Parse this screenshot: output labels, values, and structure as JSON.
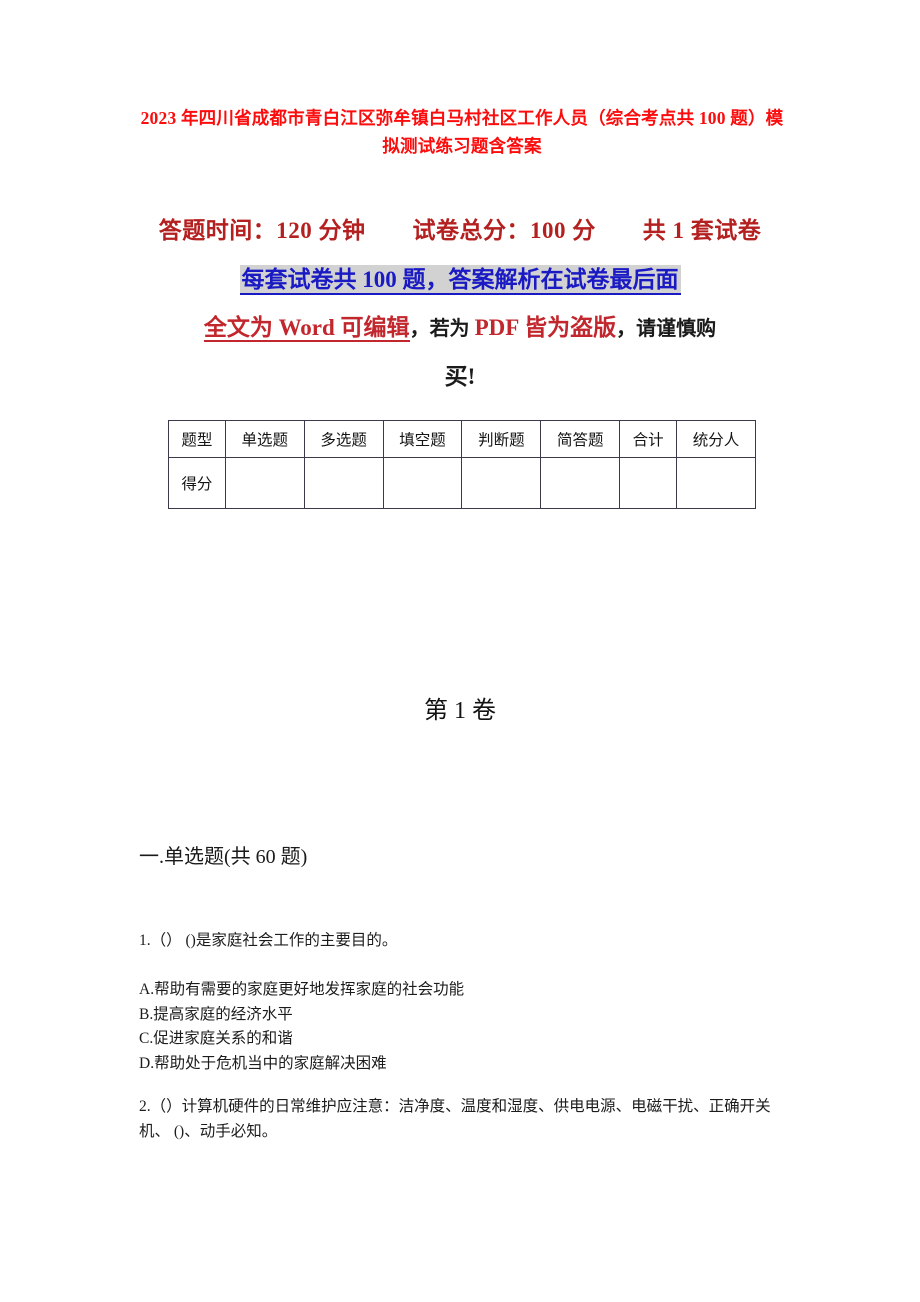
{
  "document": {
    "title": "2023 年四川省成都市青白江区弥牟镇白马村社区工作人员（综合考点共 100 题）模拟测试练习题含答案",
    "colors": {
      "title_red": "#FB0D0D",
      "info_dark_red": "#B4201F",
      "link_blue": "#1A1AC4",
      "highlight_bg": "#D2D2D2",
      "brick_red": "#C1272D",
      "table_border": "#3A3A4A"
    }
  },
  "info": {
    "line1": "答题时间：120 分钟　　试卷总分：100 分　　共 1 套试卷",
    "line2_highlighted": "每套试卷共 100 题，答案解析在试卷最后面",
    "line3_word": "全文为 Word 可编辑",
    "line3_comma": "，",
    "line3_plain": "若为 ",
    "line3_pdf": "PDF 皆为盗版",
    "line3_tail": "，请谨慎购",
    "line4": "买!"
  },
  "score_table": {
    "headers": [
      "题型",
      "单选题",
      "多选题",
      "填空题",
      "判断题",
      "简答题",
      "合计",
      "统分人"
    ],
    "rows": [
      {
        "label": "得分",
        "cells": [
          "",
          "",
          "",
          "",
          "",
          "",
          ""
        ]
      }
    ]
  },
  "volume": {
    "heading": "第 1 卷"
  },
  "section": {
    "heading": "一.单选题(共 60 题)"
  },
  "questions": [
    {
      "number": "1",
      "stem": "1.（） ()是家庭社会工作的主要目的。",
      "options": [
        "A.帮助有需要的家庭更好地发挥家庭的社会功能",
        "B.提高家庭的经济水平",
        "C.促进家庭关系的和谐",
        "D.帮助处于危机当中的家庭解决困难"
      ]
    },
    {
      "number": "2",
      "stem": "2.（）计算机硬件的日常维护应注意：洁净度、温度和湿度、供电电源、电磁干扰、正确开关机、 ()、动手必知。",
      "options": []
    }
  ]
}
